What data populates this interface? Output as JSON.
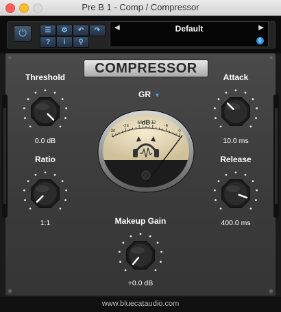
{
  "window": {
    "title": "Pre B 1 - Comp / Compressor"
  },
  "toolbar": {
    "preset_name": "Default",
    "preset_count": "0"
  },
  "plugin": {
    "title": "COMPRESSOR",
    "meter_source": "GR",
    "meter_unit": "- dB -",
    "meter_scale": [
      "-30",
      "-24",
      "-18",
      "-12",
      "-6",
      "0"
    ]
  },
  "controls": {
    "threshold": {
      "label": "Threshold",
      "value": "0.0 dB"
    },
    "ratio": {
      "label": "Ratio",
      "value": "1:1"
    },
    "attack": {
      "label": "Attack",
      "value": "10.0 ms"
    },
    "release": {
      "label": "Release",
      "value": "400.0 ms"
    },
    "makeup": {
      "label": "Makeup Gain",
      "value": "+0.0 dB"
    }
  },
  "footer": {
    "url": "www.bluecataudio.com"
  },
  "colors": {
    "accent": "#3ea3ff",
    "meter_face": "#efe4c0",
    "panel": "#404040"
  }
}
